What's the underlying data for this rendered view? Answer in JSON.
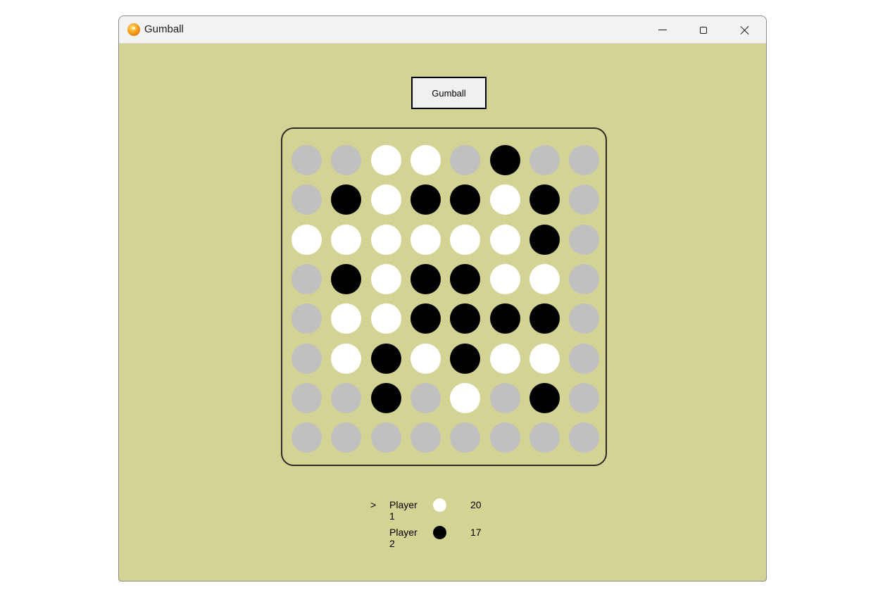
{
  "window": {
    "title": "Gumball"
  },
  "controls": {
    "new_game_label": "Gumball"
  },
  "colors": {
    "background": "#d3d393",
    "empty": "#c0c0c0",
    "white": "#ffffff",
    "black": "#000000"
  },
  "board": {
    "rows": [
      [
        "e",
        "e",
        "w",
        "w",
        "e",
        "b",
        "e",
        "e"
      ],
      [
        "e",
        "b",
        "w",
        "b",
        "b",
        "w",
        "b",
        "e"
      ],
      [
        "w",
        "w",
        "w",
        "w",
        "w",
        "w",
        "b",
        "e"
      ],
      [
        "e",
        "b",
        "w",
        "b",
        "b",
        "w",
        "w",
        "e"
      ],
      [
        "e",
        "w",
        "w",
        "b",
        "b",
        "b",
        "b",
        "e"
      ],
      [
        "e",
        "w",
        "b",
        "w",
        "b",
        "w",
        "w",
        "e"
      ],
      [
        "e",
        "e",
        "b",
        "e",
        "w",
        "e",
        "b",
        "e"
      ],
      [
        "e",
        "e",
        "e",
        "e",
        "e",
        "e",
        "e",
        "e"
      ]
    ]
  },
  "players": [
    {
      "name": "Player 1",
      "color": "white",
      "score": "20",
      "active": true
    },
    {
      "name": "Player 2",
      "color": "black",
      "score": "17",
      "active": false
    }
  ],
  "turn_marker": ">"
}
